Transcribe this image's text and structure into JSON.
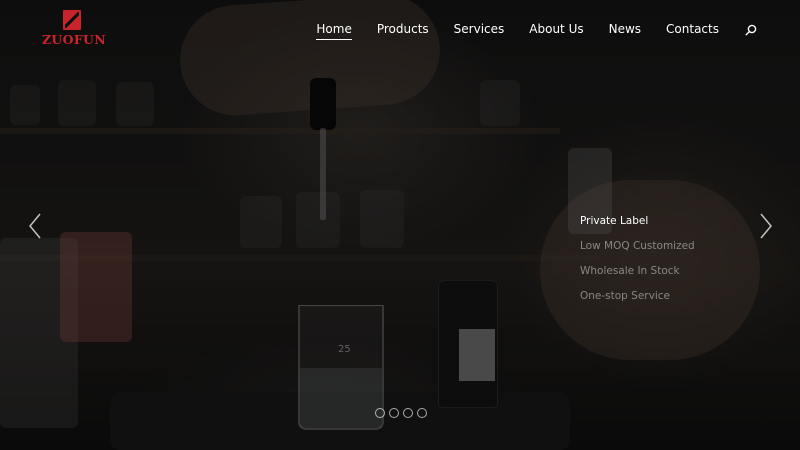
{
  "brand": {
    "name": "ZUOFUN",
    "color": "#c8242a"
  },
  "nav": {
    "items": [
      {
        "label": "Home",
        "active": true
      },
      {
        "label": "Products"
      },
      {
        "label": "Services"
      },
      {
        "label": "About Us"
      },
      {
        "label": "News"
      },
      {
        "label": "Contacts"
      }
    ],
    "search_icon": "search-icon"
  },
  "hero": {
    "image_subject": "hand-with-dropper-lab-scene",
    "features": [
      {
        "label": "Private Label",
        "active": true
      },
      {
        "label": "Low MOQ Customized"
      },
      {
        "label": "Wholesale In Stock"
      },
      {
        "label": "One-stop Service"
      }
    ],
    "beaker_mark": "25",
    "prev_icon": "chevron-left-icon",
    "next_icon": "chevron-right-icon",
    "slides_count": 4,
    "active_slide": 1
  }
}
